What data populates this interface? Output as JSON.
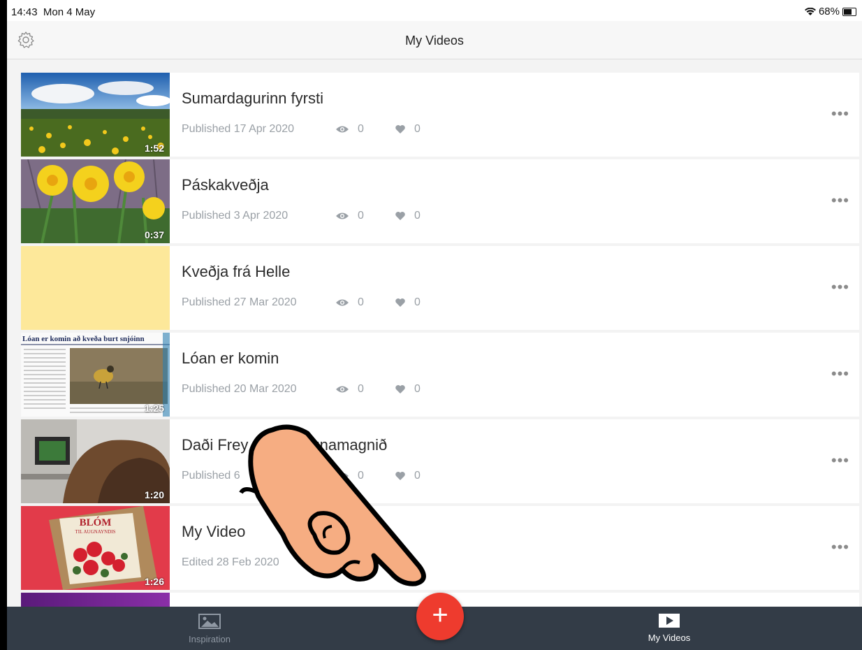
{
  "status": {
    "time": "14:43",
    "date": "Mon 4 May",
    "battery": "68%"
  },
  "nav": {
    "title": "My Videos"
  },
  "videos": [
    {
      "title": "Sumardagurinn fyrsti",
      "meta": "Published 17 Apr 2020",
      "views": "0",
      "likes": "0",
      "duration": "1:52"
    },
    {
      "title": "Páskakveðja",
      "meta": "Published 3 Apr 2020",
      "views": "0",
      "likes": "0",
      "duration": "0:37"
    },
    {
      "title": "Kveðja frá Helle",
      "meta": "Published 27 Mar 2020",
      "views": "0",
      "likes": "0",
      "duration": ""
    },
    {
      "title": "Lóan er komin",
      "meta": "Published 20 Mar 2020",
      "views": "0",
      "likes": "0",
      "duration": "1:25",
      "thumb_text": "Lóan er komin að kveða burt snjóinn"
    },
    {
      "title": "Daði Frey",
      "title_tail": "gnamagnið",
      "meta": "Published 6",
      "views": "0",
      "likes": "0",
      "duration": "1:20"
    },
    {
      "title": "My Video",
      "meta": "Edited 28 Feb 2020",
      "duration": "1:26",
      "thumb_text_1": "BLÓM",
      "thumb_text_2": "TIL AUGNAYNDIS"
    }
  ],
  "more_label": "•••",
  "tabs": {
    "inspiration": "Inspiration",
    "my_videos": "My Videos"
  },
  "fab_label": "+",
  "icons": {
    "settings": "gear-icon",
    "views": "eye-icon",
    "likes": "heart-icon",
    "inspiration": "photo-icon",
    "my_videos": "play-icon",
    "pointer": "pointing-hand-icon"
  },
  "colors": {
    "accent": "#ee3b2e",
    "tabbar": "#333c47",
    "muted": "#9aa0a6"
  }
}
